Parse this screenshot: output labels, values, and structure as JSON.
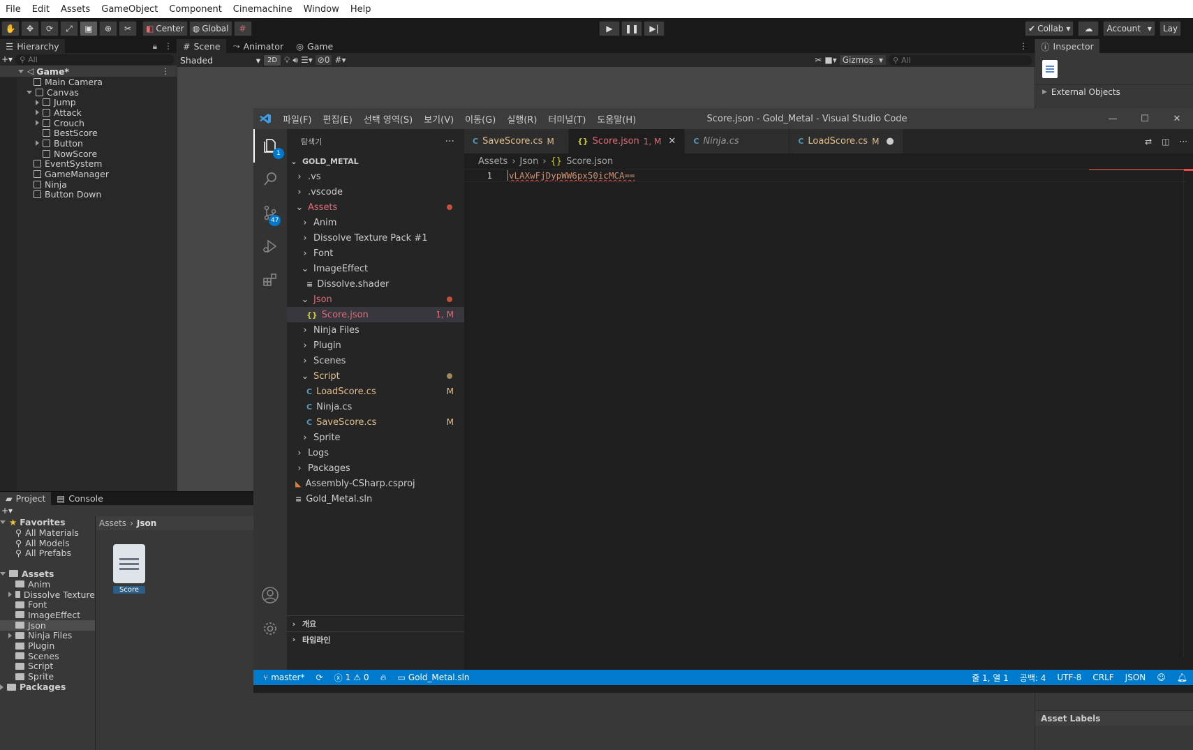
{
  "unity": {
    "menu": [
      "File",
      "Edit",
      "Assets",
      "GameObject",
      "Component",
      "Cinemachine",
      "Window",
      "Help"
    ],
    "toolbar": {
      "center": "Center",
      "global": "Global",
      "collab": "Collab",
      "account": "Account",
      "layout": "Lay"
    },
    "hierarchy": {
      "tab": "Hierarchy",
      "search_placeholder": "All",
      "scene": "Game*",
      "items": [
        {
          "label": "Main Camera",
          "indent": 1,
          "arrow": ""
        },
        {
          "label": "Canvas",
          "indent": 1,
          "arrow": "down"
        },
        {
          "label": "Jump",
          "indent": 2,
          "arrow": "right"
        },
        {
          "label": "Attack",
          "indent": 2,
          "arrow": "right"
        },
        {
          "label": "Crouch",
          "indent": 2,
          "arrow": "right"
        },
        {
          "label": "BestScore",
          "indent": 2,
          "arrow": ""
        },
        {
          "label": "Button",
          "indent": 2,
          "arrow": "right"
        },
        {
          "label": "NowScore",
          "indent": 2,
          "arrow": ""
        },
        {
          "label": "EventSystem",
          "indent": 1,
          "arrow": ""
        },
        {
          "label": "GameManager",
          "indent": 1,
          "arrow": ""
        },
        {
          "label": "Ninja",
          "indent": 1,
          "arrow": ""
        },
        {
          "label": "Button Down",
          "indent": 1,
          "arrow": ""
        }
      ]
    },
    "scene_tabs": {
      "scene": "Scene",
      "animator": "Animator",
      "game": "Game",
      "shaded": "Shaded",
      "mode2d": "2D",
      "hidden": "0",
      "gizmos": "Gizmos",
      "search_placeholder": "All"
    },
    "inspector": {
      "tab": "Inspector",
      "external": "External Objects",
      "asset_labels": "Asset Labels"
    },
    "project": {
      "tab_project": "Project",
      "tab_console": "Console",
      "favorites": "Favorites",
      "fav_items": [
        "All Materials",
        "All Models",
        "All Prefabs"
      ],
      "assets": "Assets",
      "asset_items": [
        {
          "label": "Anim",
          "arrow": false
        },
        {
          "label": "Dissolve Texture",
          "arrow": true
        },
        {
          "label": "Font",
          "arrow": false
        },
        {
          "label": "ImageEffect",
          "arrow": false
        },
        {
          "label": "Json",
          "arrow": false,
          "selected": true
        },
        {
          "label": "Ninja Files",
          "arrow": true
        },
        {
          "label": "Plugin",
          "arrow": false
        },
        {
          "label": "Scenes",
          "arrow": false
        },
        {
          "label": "Script",
          "arrow": false
        },
        {
          "label": "Sprite",
          "arrow": false
        }
      ],
      "packages": "Packages",
      "breadcrumb": [
        "Assets",
        "Json"
      ],
      "file_label": "Score"
    }
  },
  "vscode": {
    "menu": [
      "파일(F)",
      "편집(E)",
      "선택 영역(S)",
      "보기(V)",
      "이동(G)",
      "실행(R)",
      "터미널(T)",
      "도움말(H)"
    ],
    "title": "Score.json - Gold_Metal - Visual Studio Code",
    "explorer_title": "탐색기",
    "root": "GOLD_METAL",
    "tree": [
      {
        "label": ".vs",
        "indent": 0,
        "chev": "right",
        "color": "#cccccc"
      },
      {
        "label": ".vscode",
        "indent": 0,
        "chev": "right",
        "color": "#cccccc"
      },
      {
        "label": "Assets",
        "indent": 0,
        "chev": "down",
        "color": "#e06c75",
        "dot": "#c74e39"
      },
      {
        "label": "Anim",
        "indent": 1,
        "chev": "right",
        "color": "#cccccc"
      },
      {
        "label": "Dissolve Texture Pack #1",
        "indent": 1,
        "chev": "right",
        "color": "#cccccc"
      },
      {
        "label": "Font",
        "indent": 1,
        "chev": "right",
        "color": "#cccccc"
      },
      {
        "label": "ImageEffect",
        "indent": 1,
        "chev": "down",
        "color": "#cccccc"
      },
      {
        "label": "Dissolve.shader",
        "indent": 2,
        "chev": "",
        "icon": "lines",
        "color": "#cccccc"
      },
      {
        "label": "Json",
        "indent": 1,
        "chev": "down",
        "color": "#e06c75",
        "dot": "#c74e39"
      },
      {
        "label": "Score.json",
        "indent": 2,
        "chev": "",
        "icon": "json",
        "color": "#e06c75",
        "mod": "1, M",
        "selected": true
      },
      {
        "label": "Ninja Files",
        "indent": 1,
        "chev": "right",
        "color": "#cccccc"
      },
      {
        "label": "Plugin",
        "indent": 1,
        "chev": "right",
        "color": "#cccccc"
      },
      {
        "label": "Scenes",
        "indent": 1,
        "chev": "right",
        "color": "#cccccc"
      },
      {
        "label": "Script",
        "indent": 1,
        "chev": "down",
        "color": "#e2c08d",
        "dot": "#a0895a"
      },
      {
        "label": "LoadScore.cs",
        "indent": 2,
        "chev": "",
        "icon": "cs",
        "color": "#e2c08d",
        "mod": "M"
      },
      {
        "label": "Ninja.cs",
        "indent": 2,
        "chev": "",
        "icon": "cs",
        "color": "#cccccc"
      },
      {
        "label": "SaveScore.cs",
        "indent": 2,
        "chev": "",
        "icon": "cs",
        "color": "#e2c08d",
        "mod": "M"
      },
      {
        "label": "Sprite",
        "indent": 1,
        "chev": "right",
        "color": "#cccccc"
      },
      {
        "label": "Logs",
        "indent": 0,
        "chev": "right",
        "color": "#cccccc"
      },
      {
        "label": "Packages",
        "indent": 0,
        "chev": "right",
        "color": "#cccccc"
      },
      {
        "label": "Assembly-CSharp.csproj",
        "indent": 0,
        "chev": "",
        "icon": "rss",
        "color": "#cccccc"
      },
      {
        "label": "Gold_Metal.sln",
        "indent": 0,
        "chev": "",
        "icon": "lines",
        "color": "#cccccc"
      }
    ],
    "outline": "개요",
    "timeline": "타임라인",
    "tabs": [
      {
        "label": "SaveScore.cs",
        "mod": "M",
        "color": "#e2c08d",
        "italic": false
      },
      {
        "label": "Score.json",
        "mod": "1, M",
        "color": "#e06c75",
        "active": true,
        "italic": false
      },
      {
        "label": "Ninja.cs",
        "mod": "",
        "color": "#969696",
        "italic": true
      },
      {
        "label": "LoadScore.cs",
        "mod": "M",
        "color": "#e2c08d",
        "italic": false,
        "dirty": true
      }
    ],
    "breadcrumb": [
      "Assets",
      "Json",
      "Score.json"
    ],
    "line_number": "1",
    "code": "vLAXwFjDypWW6px50icMCA==",
    "explorer_badge": "1",
    "scm_badge": "47",
    "status": {
      "branch": "master*",
      "errors": "1",
      "warnings": "0",
      "solution": "Gold_Metal.sln",
      "position": "줄 1, 열 1",
      "spaces": "공백: 4",
      "encoding": "UTF-8",
      "eol": "CRLF",
      "language": "JSON"
    }
  }
}
